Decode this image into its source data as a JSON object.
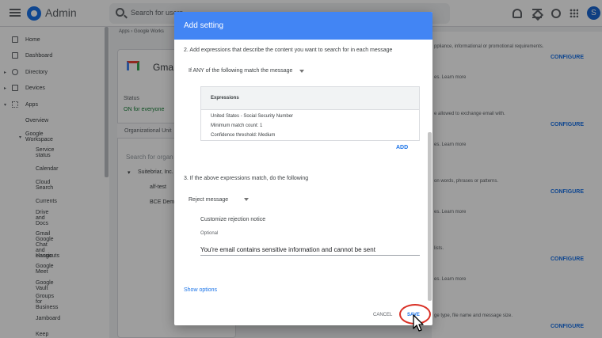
{
  "topbar": {
    "title": "Admin",
    "search_placeholder": "Search for users",
    "avatar_initial": "S"
  },
  "sidebar": {
    "items": [
      {
        "label": "Home"
      },
      {
        "label": "Dashboard"
      },
      {
        "label": "Directory"
      },
      {
        "label": "Devices"
      },
      {
        "label": "Apps"
      },
      {
        "label": "Overview"
      },
      {
        "label": "Google Workspace"
      },
      {
        "label": "Service status"
      },
      {
        "label": "Calendar"
      },
      {
        "label": "Cloud Search"
      },
      {
        "label": "Currents"
      },
      {
        "label": "Drive and Docs"
      },
      {
        "label": "Gmail"
      },
      {
        "label": "Google Chat and classic"
      },
      {
        "label": "Hangouts"
      },
      {
        "label": "Google Meet"
      },
      {
        "label": "Google Vault"
      },
      {
        "label": "Groups for Business"
      },
      {
        "label": "Jamboard"
      },
      {
        "label": "Keep"
      }
    ]
  },
  "main": {
    "breadcrumb": "Apps  ›  Google Works",
    "gmail_name": "Gma",
    "status_label": "Status",
    "status_value": "ON for everyone",
    "ou_label": "Organizational Unit",
    "org_search": "Search for organ",
    "tree": [
      {
        "label": "Suitebriar, Inc."
      },
      {
        "label": "alf-test"
      },
      {
        "label": "BCE Demo"
      }
    ],
    "right_panel": {
      "texts": [
        "ppliance, informational or promotional requirements.",
        "es. Learn more",
        "e allowed to exchange email with.",
        "es. Learn more",
        "on words, phrases or patterns.",
        "es. Learn more",
        "lists.",
        "es. Learn more",
        "ge type, file name and message size."
      ],
      "configure_label": "CONFIGURE"
    }
  },
  "dialog": {
    "title": "Add setting",
    "step2_label": "2. Add expressions that describe the content you want to search for in each message",
    "match_dropdown": "If ANY of the following match the message",
    "expressions_header": "Expressions",
    "expression_lines": [
      "United States - Social Security Number",
      "Minimum match count: 1",
      "Confidence threshold: Medium"
    ],
    "add_label": "ADD",
    "step3_label": "3. If the above expressions match, do the following",
    "action_dropdown": "Reject message",
    "customize_label": "Customize rejection notice",
    "optional_label": "Optional",
    "rejection_notice_value": "You're email contains sensitive information and cannot be sent",
    "show_options": "Show options",
    "cancel_label": "CANCEL",
    "save_label": "SAVE"
  },
  "colors": {
    "dialog_header": "#4285f4",
    "link": "#1a73e8",
    "status_on": "#188038",
    "highlight_circle": "#d93025"
  }
}
